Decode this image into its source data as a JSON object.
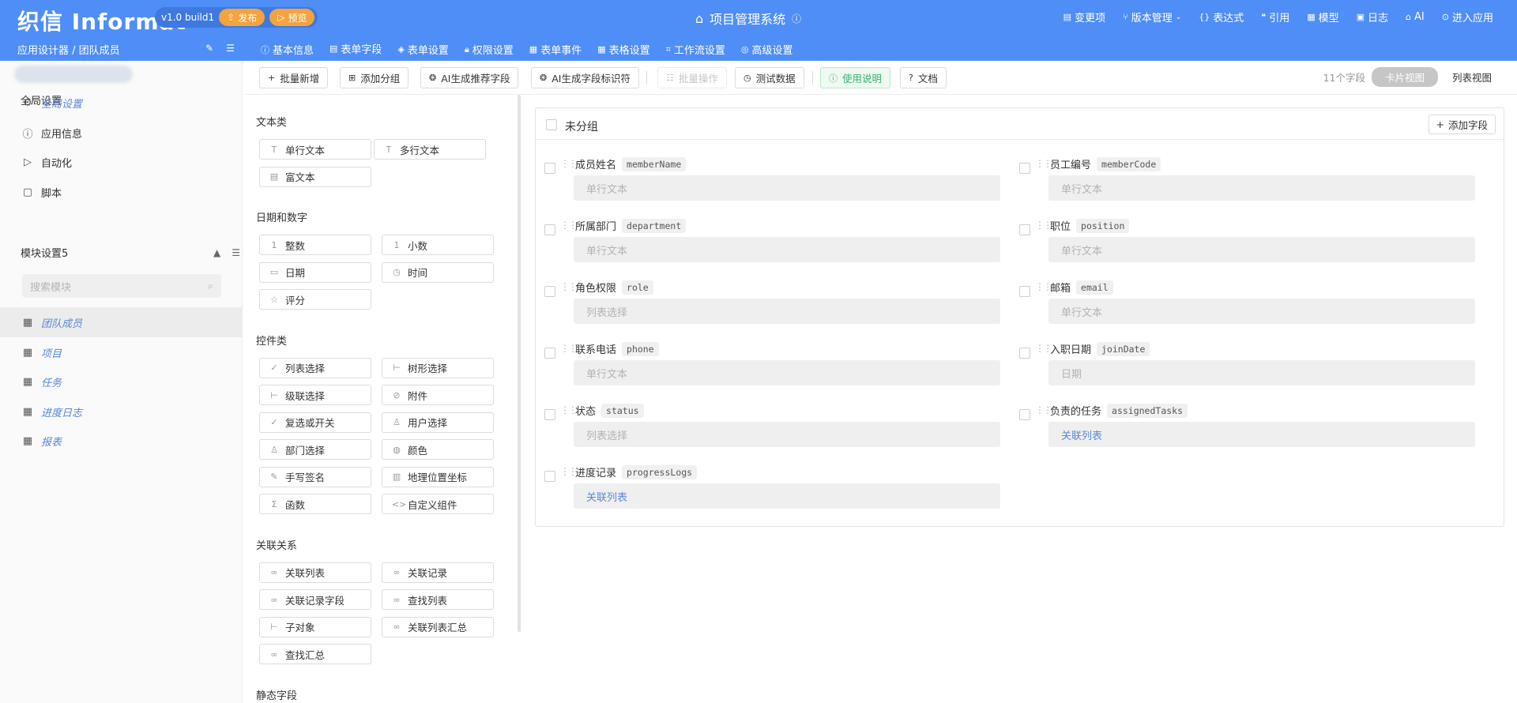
{
  "header": {
    "logo": "织信 Informat",
    "version": "v1.0 build1",
    "publish_label": "发布",
    "preview_label": "预览",
    "app_title": "项目管理系统",
    "nav": [
      {
        "label": "变更项",
        "icon": "list-icon"
      },
      {
        "label": "版本管理",
        "icon": "branch-icon"
      },
      {
        "label": "表达式",
        "icon": "braces-icon"
      },
      {
        "label": "引用",
        "icon": "quote-icon"
      },
      {
        "label": "模型",
        "icon": "grid-icon"
      },
      {
        "label": "日志",
        "icon": "image-icon"
      },
      {
        "label": "AI",
        "icon": "robot-icon"
      },
      {
        "label": "进入应用",
        "icon": "enter-icon"
      }
    ],
    "breadcrumb": "应用设计器 / 团队成员",
    "tabs": [
      {
        "label": "基本信息",
        "icon": "info-icon",
        "active": false
      },
      {
        "label": "表单字段",
        "icon": "form-icon",
        "active": true
      },
      {
        "label": "表单设置",
        "icon": "layers-icon",
        "active": false
      },
      {
        "label": "权限设置",
        "icon": "lock-icon",
        "active": false
      },
      {
        "label": "表单事件",
        "icon": "event-icon",
        "active": false
      },
      {
        "label": "表格设置",
        "icon": "table-icon",
        "active": false
      },
      {
        "label": "工作流设置",
        "icon": "workflow-icon",
        "active": false
      },
      {
        "label": "高级设置",
        "icon": "database-icon",
        "active": false
      }
    ]
  },
  "sidebar": {
    "global_heading": "全局设置",
    "global_items": [
      {
        "label": "全局设置",
        "icon": "gear-icon",
        "link": true
      },
      {
        "label": "应用信息",
        "icon": "info-icon",
        "link": false
      },
      {
        "label": "自动化",
        "icon": "play-icon",
        "link": false
      },
      {
        "label": "脚本",
        "icon": "script-icon",
        "link": false
      }
    ],
    "module_heading": "模块设置5",
    "search_placeholder": "搜索模块",
    "modules": [
      {
        "label": "团队成员",
        "active": true
      },
      {
        "label": "项目",
        "active": false
      },
      {
        "label": "任务",
        "active": false
      },
      {
        "label": "进度日志",
        "active": false
      },
      {
        "label": "报表",
        "active": false
      }
    ]
  },
  "toolbar": {
    "buttons": [
      {
        "label": "批量新增",
        "icon": "plus-icon",
        "state": "normal"
      },
      {
        "label": "添加分组",
        "icon": "add-group-icon",
        "state": "normal"
      },
      {
        "label": "AI生成推荐字段",
        "icon": "ai-icon",
        "state": "normal"
      },
      {
        "label": "AI生成字段标识符",
        "icon": "ai-icon",
        "state": "normal"
      },
      {
        "label": "批量操作",
        "icon": "batch-icon",
        "state": "disabled"
      },
      {
        "label": "测试数据",
        "icon": "clock-icon",
        "state": "normal"
      },
      {
        "label": "使用说明",
        "icon": "info-icon",
        "state": "green"
      },
      {
        "label": "文档",
        "icon": "help-icon",
        "state": "normal"
      }
    ],
    "field_count": "11个字段",
    "card_view": "卡片视图",
    "list_view": "列表视图"
  },
  "palette": {
    "sections": [
      {
        "title": "文本类",
        "items": [
          {
            "label": "单行文本",
            "icon": "T"
          },
          {
            "label": "多行文本",
            "icon": "T"
          },
          {
            "label": "富文本",
            "icon": "▤"
          }
        ]
      },
      {
        "title": "日期和数字",
        "items": [
          {
            "label": "整数",
            "icon": "1"
          },
          {
            "label": "小数",
            "icon": "1"
          },
          {
            "label": "日期",
            "icon": "▭"
          },
          {
            "label": "时间",
            "icon": "◷"
          },
          {
            "label": "评分",
            "icon": "☆"
          }
        ]
      },
      {
        "title": "控件类",
        "items": [
          {
            "label": "列表选择",
            "icon": "✓"
          },
          {
            "label": "树形选择",
            "icon": "⊢"
          },
          {
            "label": "级联选择",
            "icon": "⊢"
          },
          {
            "label": "附件",
            "icon": "⊘"
          },
          {
            "label": "复选或开关",
            "icon": "✓"
          },
          {
            "label": "用户选择",
            "icon": "♙"
          },
          {
            "label": "部门选择",
            "icon": "♙"
          },
          {
            "label": "颜色",
            "icon": "◍"
          },
          {
            "label": "手写签名",
            "icon": "✎"
          },
          {
            "label": "地理位置坐标",
            "icon": "▥"
          },
          {
            "label": "函数",
            "icon": "Σ"
          },
          {
            "label": "自定义组件",
            "icon": "<>"
          }
        ]
      },
      {
        "title": "关联关系",
        "items": [
          {
            "label": "关联列表",
            "icon": "∞"
          },
          {
            "label": "关联记录",
            "icon": "∞"
          },
          {
            "label": "关联记录字段",
            "icon": "∞"
          },
          {
            "label": "查找列表",
            "icon": "∞"
          },
          {
            "label": "子对象",
            "icon": "⊢"
          },
          {
            "label": "关联列表汇总",
            "icon": "∞"
          },
          {
            "label": "查找汇总",
            "icon": "∞"
          }
        ]
      },
      {
        "title": "静态字段",
        "items": []
      }
    ]
  },
  "group": {
    "title": "未分组",
    "add_field": "添加字段",
    "fields": [
      {
        "label": "成员姓名",
        "code": "memberName",
        "placeholder": "单行文本",
        "link": false
      },
      {
        "label": "员工编号",
        "code": "memberCode",
        "placeholder": "单行文本",
        "link": false
      },
      {
        "label": "所属部门",
        "code": "department",
        "placeholder": "单行文本",
        "link": false
      },
      {
        "label": "职位",
        "code": "position",
        "placeholder": "单行文本",
        "link": false
      },
      {
        "label": "角色权限",
        "code": "role",
        "placeholder": "列表选择",
        "link": false
      },
      {
        "label": "邮箱",
        "code": "email",
        "placeholder": "单行文本",
        "link": false
      },
      {
        "label": "联系电话",
        "code": "phone",
        "placeholder": "单行文本",
        "link": false
      },
      {
        "label": "入职日期",
        "code": "joinDate",
        "placeholder": "日期",
        "link": false
      },
      {
        "label": "状态",
        "code": "status",
        "placeholder": "列表选择",
        "link": false
      },
      {
        "label": "负责的任务",
        "code": "assignedTasks",
        "placeholder": "关联列表",
        "link": true
      },
      {
        "label": "进度记录",
        "code": "progressLogs",
        "placeholder": "关联列表",
        "link": true
      }
    ]
  },
  "colors": {
    "header": "#4f8ef7",
    "accent": "#5a87d8",
    "orange": "#f5a33d",
    "green": "#38b26c"
  }
}
